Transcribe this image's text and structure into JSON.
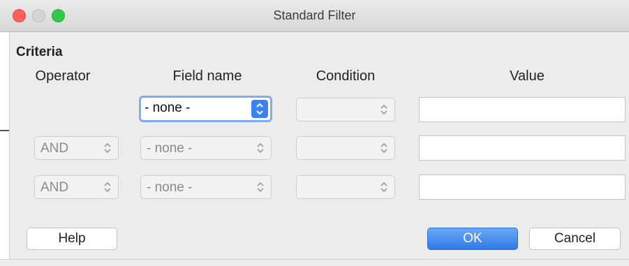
{
  "window": {
    "title": "Standard Filter"
  },
  "criteria": {
    "heading": "Criteria",
    "columns": {
      "operator": "Operator",
      "field_name": "Field name",
      "condition": "Condition",
      "value": "Value"
    },
    "rows": [
      {
        "operator": "",
        "field_name": "- none -",
        "condition": "",
        "value": ""
      },
      {
        "operator": "AND",
        "field_name": "- none -",
        "condition": "",
        "value": ""
      },
      {
        "operator": "AND",
        "field_name": "- none -",
        "condition": "",
        "value": ""
      }
    ]
  },
  "buttons": {
    "help": "Help",
    "ok": "OK",
    "cancel": "Cancel"
  },
  "colors": {
    "accent": "#3a83f1",
    "close": "#fc605c",
    "zoom": "#34c84a"
  },
  "icons": [
    "chevron-up-down-icon"
  ]
}
